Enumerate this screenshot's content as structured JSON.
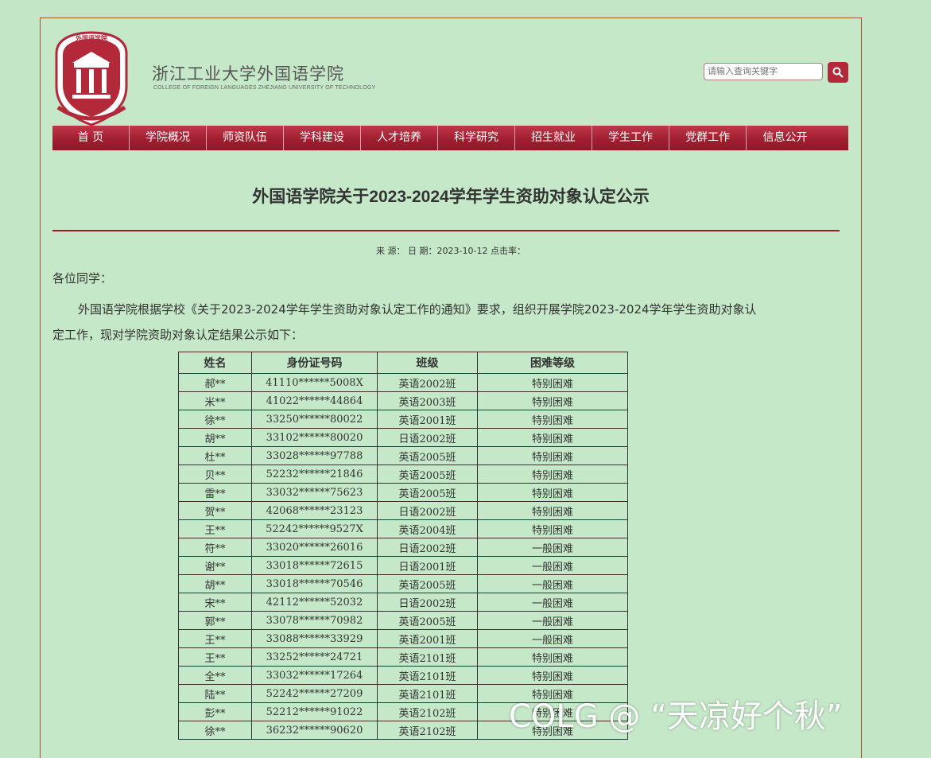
{
  "header": {
    "college_cn": "浙江工业大学外国语学院",
    "college_en": "COLLEGE OF FOREIGN LANGUAGES ZHEJIANG UNIVERSITY OF TECHNOLOGY",
    "seal_top_text": "外国语学院",
    "search_placeholder": "请输入查询关键字"
  },
  "nav": [
    "首 页",
    "学院概况",
    "师资队伍",
    "学科建设",
    "人才培养",
    "科学研究",
    "招生就业",
    "学生工作",
    "党群工作",
    "信息公开"
  ],
  "article": {
    "title": "外国语学院关于2023-2024学年学生资助对象认定公示",
    "meta": "来 源： 日 期：2023-10-12 点击率：",
    "greeting": "各位同学：",
    "paragraph": "外国语学院根据学校《关于2023-2024学年学生资助对象认定工作的通知》要求，组织开展学院2023-2024学年学生资助对象认定工作，现对学院资助对象认定结果公示如下："
  },
  "table": {
    "headers": [
      "姓名",
      "身份证号码",
      "班级",
      "困难等级"
    ],
    "rows": [
      [
        "郝**",
        "41110******5008X",
        "英语2002班",
        "特别困难"
      ],
      [
        "米**",
        "41022******44864",
        "英语2003班",
        "特别困难"
      ],
      [
        "徐**",
        "33250******80022",
        "英语2001班",
        "特别困难"
      ],
      [
        "胡**",
        "33102******80020",
        "日语2002班",
        "特别困难"
      ],
      [
        "杜**",
        "33028******97788",
        "英语2005班",
        "特别困难"
      ],
      [
        "贝**",
        "52232******21846",
        "英语2005班",
        "特别困难"
      ],
      [
        "雷**",
        "33032******75623",
        "英语2005班",
        "特别困难"
      ],
      [
        "贺**",
        "42068******23123",
        "日语2002班",
        "特别困难"
      ],
      [
        "王**",
        "52242******9527X",
        "英语2004班",
        "特别困难"
      ],
      [
        "符**",
        "33020******26016",
        "日语2002班",
        "一般困难"
      ],
      [
        "谢**",
        "33018******72615",
        "日语2001班",
        "一般困难"
      ],
      [
        "胡**",
        "33018******70546",
        "英语2005班",
        "一般困难"
      ],
      [
        "宋**",
        "42112******52032",
        "日语2002班",
        "一般困难"
      ],
      [
        "郭**",
        "33078******70982",
        "英语2005班",
        "一般困难"
      ],
      [
        "王**",
        "33088******33929",
        "英语2001班",
        "一般困难"
      ],
      [
        "王**",
        "33252******24721",
        "英语2101班",
        "特别困难"
      ],
      [
        "全**",
        "33032******17264",
        "英语2101班",
        "特别困难"
      ],
      [
        "陆**",
        "52242******27209",
        "英语2101班",
        "特别困难"
      ],
      [
        "彭**",
        "52212******91022",
        "英语2102班",
        "特别困难"
      ],
      [
        "徐**",
        "36232******90620",
        "英语2102班",
        "特别困难"
      ]
    ]
  },
  "watermark": "COLG @ “天凉好个秋”",
  "colors": {
    "background": "#c3e6c6",
    "nav": "#a11f2f",
    "rule": "#8b2323"
  }
}
